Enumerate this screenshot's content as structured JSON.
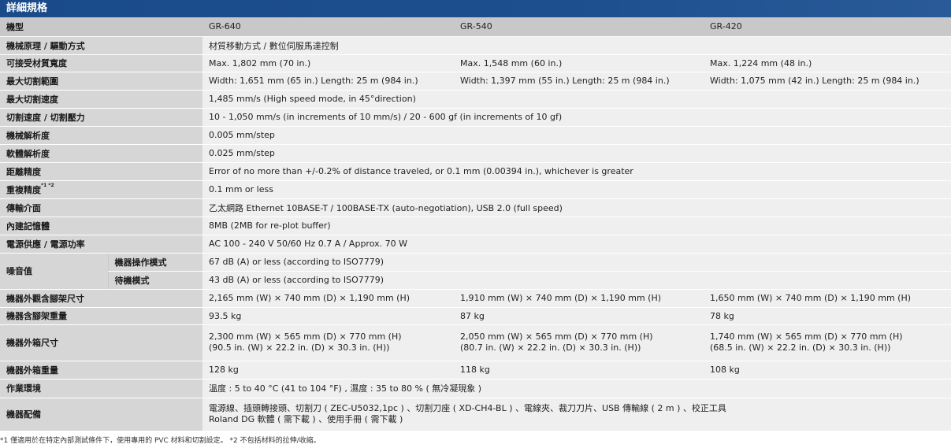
{
  "header": {
    "title": "詳細規格"
  },
  "model_row": {
    "label": "機型",
    "models": [
      "GR-640",
      "GR-540",
      "GR-420"
    ]
  },
  "rows": {
    "r1": {
      "label": "機械原理 / 驅動方式",
      "value": "材質移動方式 / 數位伺服馬達控制"
    },
    "r2": {
      "label": "可接受材質寬度",
      "v1": "Max. 1,802 mm (70 in.)",
      "v2": "Max. 1,548 mm (60 in.)",
      "v3": "Max. 1,224 mm (48 in.)"
    },
    "r3": {
      "label": "最大切割範圍",
      "v1": "Width: 1,651 mm (65 in.)   Length: 25 m (984 in.)",
      "v2": "Width: 1,397 mm (55 in.)   Length: 25 m (984 in.)",
      "v3": "Width: 1,075 mm (42 in.)   Length: 25 m (984 in.)"
    },
    "r4": {
      "label": "最大切割速度",
      "value": "1,485 mm/s (High speed mode, in 45°direction)"
    },
    "r5": {
      "label": "切割速度 / 切割壓力",
      "value": "10 - 1,050 mm/s (in increments of 10 mm/s) / 20 - 600 gf (in increments of 10 gf)"
    },
    "r6": {
      "label": "機械解析度",
      "value": "0.005 mm/step"
    },
    "r7": {
      "label": "軟體解析度",
      "value": "0.025 mm/step"
    },
    "r8": {
      "label": "距離精度",
      "value": "Error of no more than +/-0.2% of distance traveled, or 0.1 mm (0.00394 in.), whichever is greater"
    },
    "r9": {
      "label": "重複精度",
      "sup": "*1 *2",
      "value": "0.1 mm or less"
    },
    "r10": {
      "label": "傳輸介面",
      "value": "乙太網路 Ethernet 10BASE-T / 100BASE-TX (auto-negotiation), USB 2.0 (full speed)"
    },
    "r11": {
      "label": "內建記憶體",
      "value": "8MB (2MB for re-plot buffer)"
    },
    "r12": {
      "label": "電源供應 / 電源功率",
      "value": "AC 100 - 240 V   50/60 Hz   0.7 A / Approx. 70 W"
    },
    "noise": {
      "label": "噪音值",
      "sub1": {
        "label": "機器操作模式",
        "value": "67 dB (A) or less (according to ISO7779)"
      },
      "sub2": {
        "label": "待機模式",
        "value": "43 dB (A) or less (according to ISO7779)"
      }
    },
    "r14": {
      "label": "機器外觀含腳架尺寸",
      "v1": "2,165 mm (W) × 740 mm (D) × 1,190 mm (H)",
      "v2": "1,910 mm (W) × 740 mm (D) × 1,190 mm (H)",
      "v3": "1,650 mm (W) × 740 mm (D) × 1,190 mm (H)"
    },
    "r15": {
      "label": "機器含腳架重量",
      "v1": "93.5 kg",
      "v2": "87 kg",
      "v3": "78 kg"
    },
    "r16": {
      "label": "機器外箱尺寸",
      "v1a": "2,300 mm (W) × 565 mm (D) × 770 mm (H)",
      "v1b": "(90.5 in. (W) × 22.2 in. (D) × 30.3 in. (H))",
      "v2a": "2,050 mm (W) × 565 mm (D) × 770 mm (H)",
      "v2b": "(80.7 in. (W) × 22.2 in. (D) × 30.3 in. (H))",
      "v3a": "1,740 mm (W) × 565 mm (D) × 770 mm (H)",
      "v3b": "(68.5 in. (W) × 22.2 in. (D) × 30.3 in. (H))"
    },
    "r17": {
      "label": "機器外箱重量",
      "v1": "128 kg",
      "v2": "118 kg",
      "v3": "108 kg"
    },
    "r18": {
      "label": "作業環境",
      "value": "溫度 : 5 to 40 °C  (41 to 104 °F) , 濕度 : 35 to 80 % ( 無冷凝現象 )"
    },
    "r19": {
      "label": "機器配備",
      "line1": "電源線、插頭轉接頭、切割刀 ( ZEC-U5032,1pc ) 、切割刀座 ( XD-CH4-BL ) 、電線夾、裁刀刀片、USB 傳輸線 ( 2 m ) 、校正工具",
      "line2": "Roland DG 軟體 ( 需下載 ) 、使用手冊 ( 需下載 )"
    }
  },
  "footnote": "*1 僅適用於在特定內部測試條件下，使用專用的 PVC 材料和切割設定。   *2 不包括材料的拉伸/收縮。"
}
